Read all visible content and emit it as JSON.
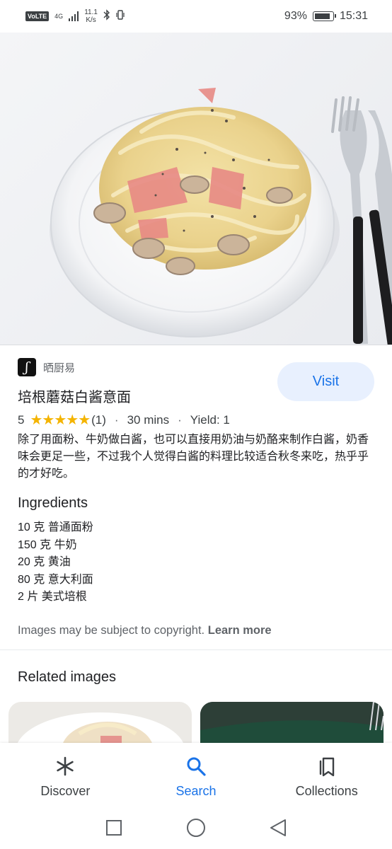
{
  "status_bar": {
    "volte": "VoLTE",
    "network": "4G",
    "speed_value": "11.1",
    "speed_unit": "K/s",
    "battery_percent": "93%",
    "battery_level": 0.93,
    "time": "15:31"
  },
  "source": {
    "logo_glyph": "ʃ",
    "name": "晒厨易"
  },
  "visit_label": "Visit",
  "recipe": {
    "title": "培根蘑菇白酱意面",
    "rating": "5",
    "stars": "★★★★★",
    "review_count": "(1)",
    "time": "30 mins",
    "yield": "Yield: 1",
    "description": "除了用面粉、牛奶做白酱，也可以直接用奶油与奶酪来制作白酱，奶香味会更足一些，不过我个人觉得白酱的料理比较适合秋冬来吃，热乎乎的才好吃。"
  },
  "ingredients": {
    "title": "Ingredients",
    "items": [
      "10 克 普通面粉",
      "150 克 牛奶",
      "20 克 黄油",
      "80 克 意大利面",
      "2 片 美式培根"
    ]
  },
  "copyright": {
    "text": "Images may be subject to copyright.",
    "link": "Learn more"
  },
  "related": {
    "title": "Related images"
  },
  "bottom_nav": [
    {
      "label": "Discover",
      "icon": "asterisk-icon"
    },
    {
      "label": "Search",
      "icon": "search-icon"
    },
    {
      "label": "Collections",
      "icon": "collections-icon"
    }
  ],
  "colors": {
    "accent": "#1a73e8",
    "star": "#f4b400",
    "visit_bg": "#e8f0fe"
  }
}
